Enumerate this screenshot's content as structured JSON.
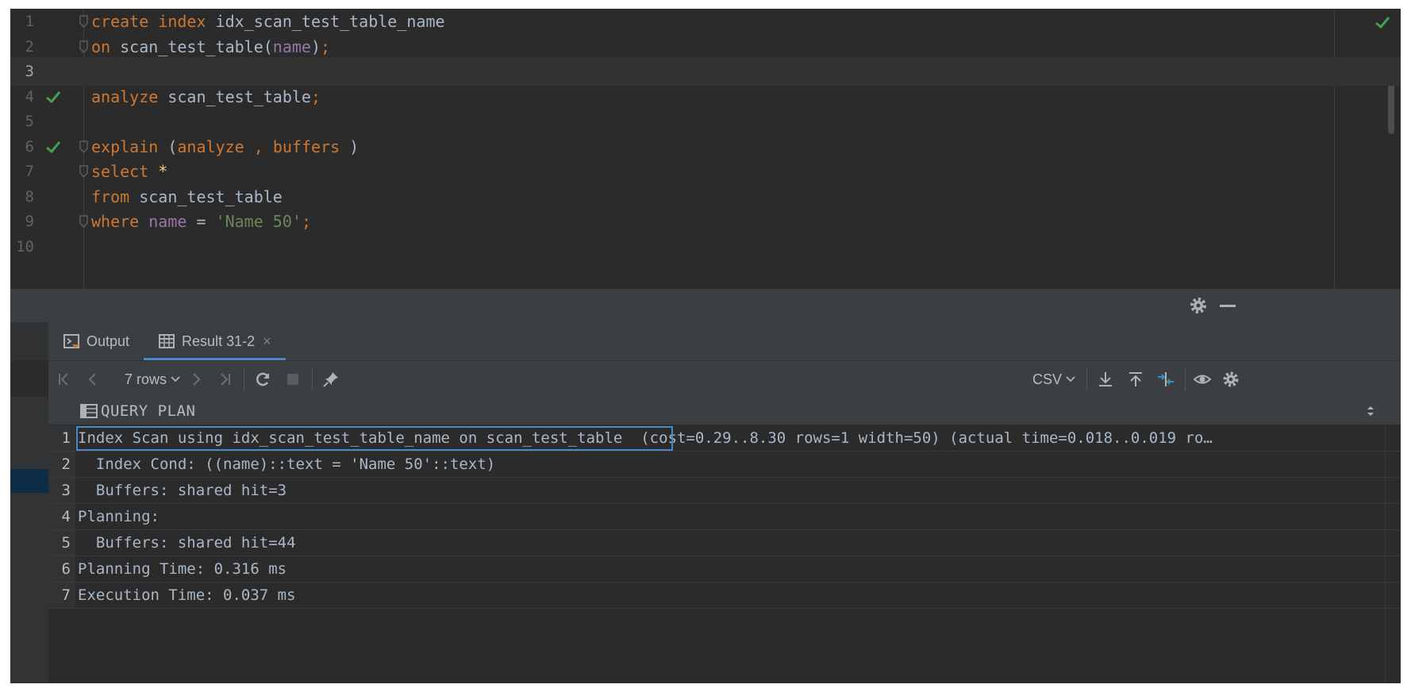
{
  "editor": {
    "lines": [
      {
        "num": "1",
        "tokens": [
          {
            "t": "create",
            "c": "kw"
          },
          {
            "t": " "
          },
          {
            "t": "index",
            "c": "kw"
          },
          {
            "t": " idx_scan_test_table_name"
          }
        ],
        "fold": true,
        "check": false
      },
      {
        "num": "2",
        "tokens": [
          {
            "t": "on",
            "c": "kw"
          },
          {
            "t": " scan_test_table("
          },
          {
            "t": "name",
            "c": "col"
          },
          {
            "t": ")"
          },
          {
            "t": ";",
            "c": "kw"
          }
        ],
        "fold": true,
        "check": false
      },
      {
        "num": "3",
        "tokens": [],
        "fold": false,
        "check": false,
        "current": true
      },
      {
        "num": "4",
        "tokens": [
          {
            "t": "analyze",
            "c": "kw"
          },
          {
            "t": " scan_test_table"
          },
          {
            "t": ";",
            "c": "kw"
          }
        ],
        "fold": false,
        "check": true
      },
      {
        "num": "5",
        "tokens": [],
        "fold": false,
        "check": false
      },
      {
        "num": "6",
        "tokens": [
          {
            "t": "explain",
            "c": "kw"
          },
          {
            "t": " ("
          },
          {
            "t": "analyze",
            "c": "kw"
          },
          {
            "t": " "
          },
          {
            "t": ",",
            "c": "kw"
          },
          {
            "t": " "
          },
          {
            "t": "buffers",
            "c": "kw"
          },
          {
            "t": " )"
          }
        ],
        "fold": true,
        "check": true
      },
      {
        "num": "7",
        "tokens": [
          {
            "t": "select",
            "c": "kw"
          },
          {
            "t": " "
          },
          {
            "t": "*",
            "c": "star"
          }
        ],
        "fold": true,
        "check": false
      },
      {
        "num": "8",
        "tokens": [
          {
            "t": "from",
            "c": "kw"
          },
          {
            "t": " scan_test_table"
          }
        ],
        "fold": false,
        "check": false
      },
      {
        "num": "9",
        "tokens": [
          {
            "t": "where",
            "c": "kw"
          },
          {
            "t": " "
          },
          {
            "t": "name",
            "c": "col"
          },
          {
            "t": " = "
          },
          {
            "t": "'Name 50'",
            "c": "str"
          },
          {
            "t": ";",
            "c": "kw"
          }
        ],
        "fold": true,
        "check": false
      },
      {
        "num": "10",
        "tokens": [],
        "fold": false,
        "check": false
      }
    ],
    "status_icon": "check-icon"
  },
  "tool_window": {
    "tabs": [
      {
        "label": "Output",
        "icon": "console-icon",
        "active": false
      },
      {
        "label": "Result 31-2",
        "icon": "table-icon",
        "active": true,
        "closable": true
      }
    ],
    "close_glyph": "×"
  },
  "toolbar": {
    "rows_label": "7 rows",
    "export_format": "CSV"
  },
  "grid": {
    "column": "QUERY PLAN",
    "rows": [
      {
        "num": "1",
        "text": "Index Scan using idx_scan_test_table_name on scan_test_table  (cost=0.29..8.30 rows=1 width=50) (actual time=0.018..0.019 ro…"
      },
      {
        "num": "2",
        "text": "  Index Cond: ((name)::text = 'Name 50'::text)"
      },
      {
        "num": "3",
        "text": "  Buffers: shared hit=3"
      },
      {
        "num": "4",
        "text": "Planning:"
      },
      {
        "num": "5",
        "text": "  Buffers: shared hit=44"
      },
      {
        "num": "6",
        "text": "Planning Time: 0.316 ms"
      },
      {
        "num": "7",
        "text": "Execution Time: 0.037 ms"
      }
    ]
  },
  "colors": {
    "keyword": "#cc7832",
    "column": "#9876aa",
    "string": "#6a8759",
    "check": "#499c54",
    "selection": "#4a88c7"
  }
}
